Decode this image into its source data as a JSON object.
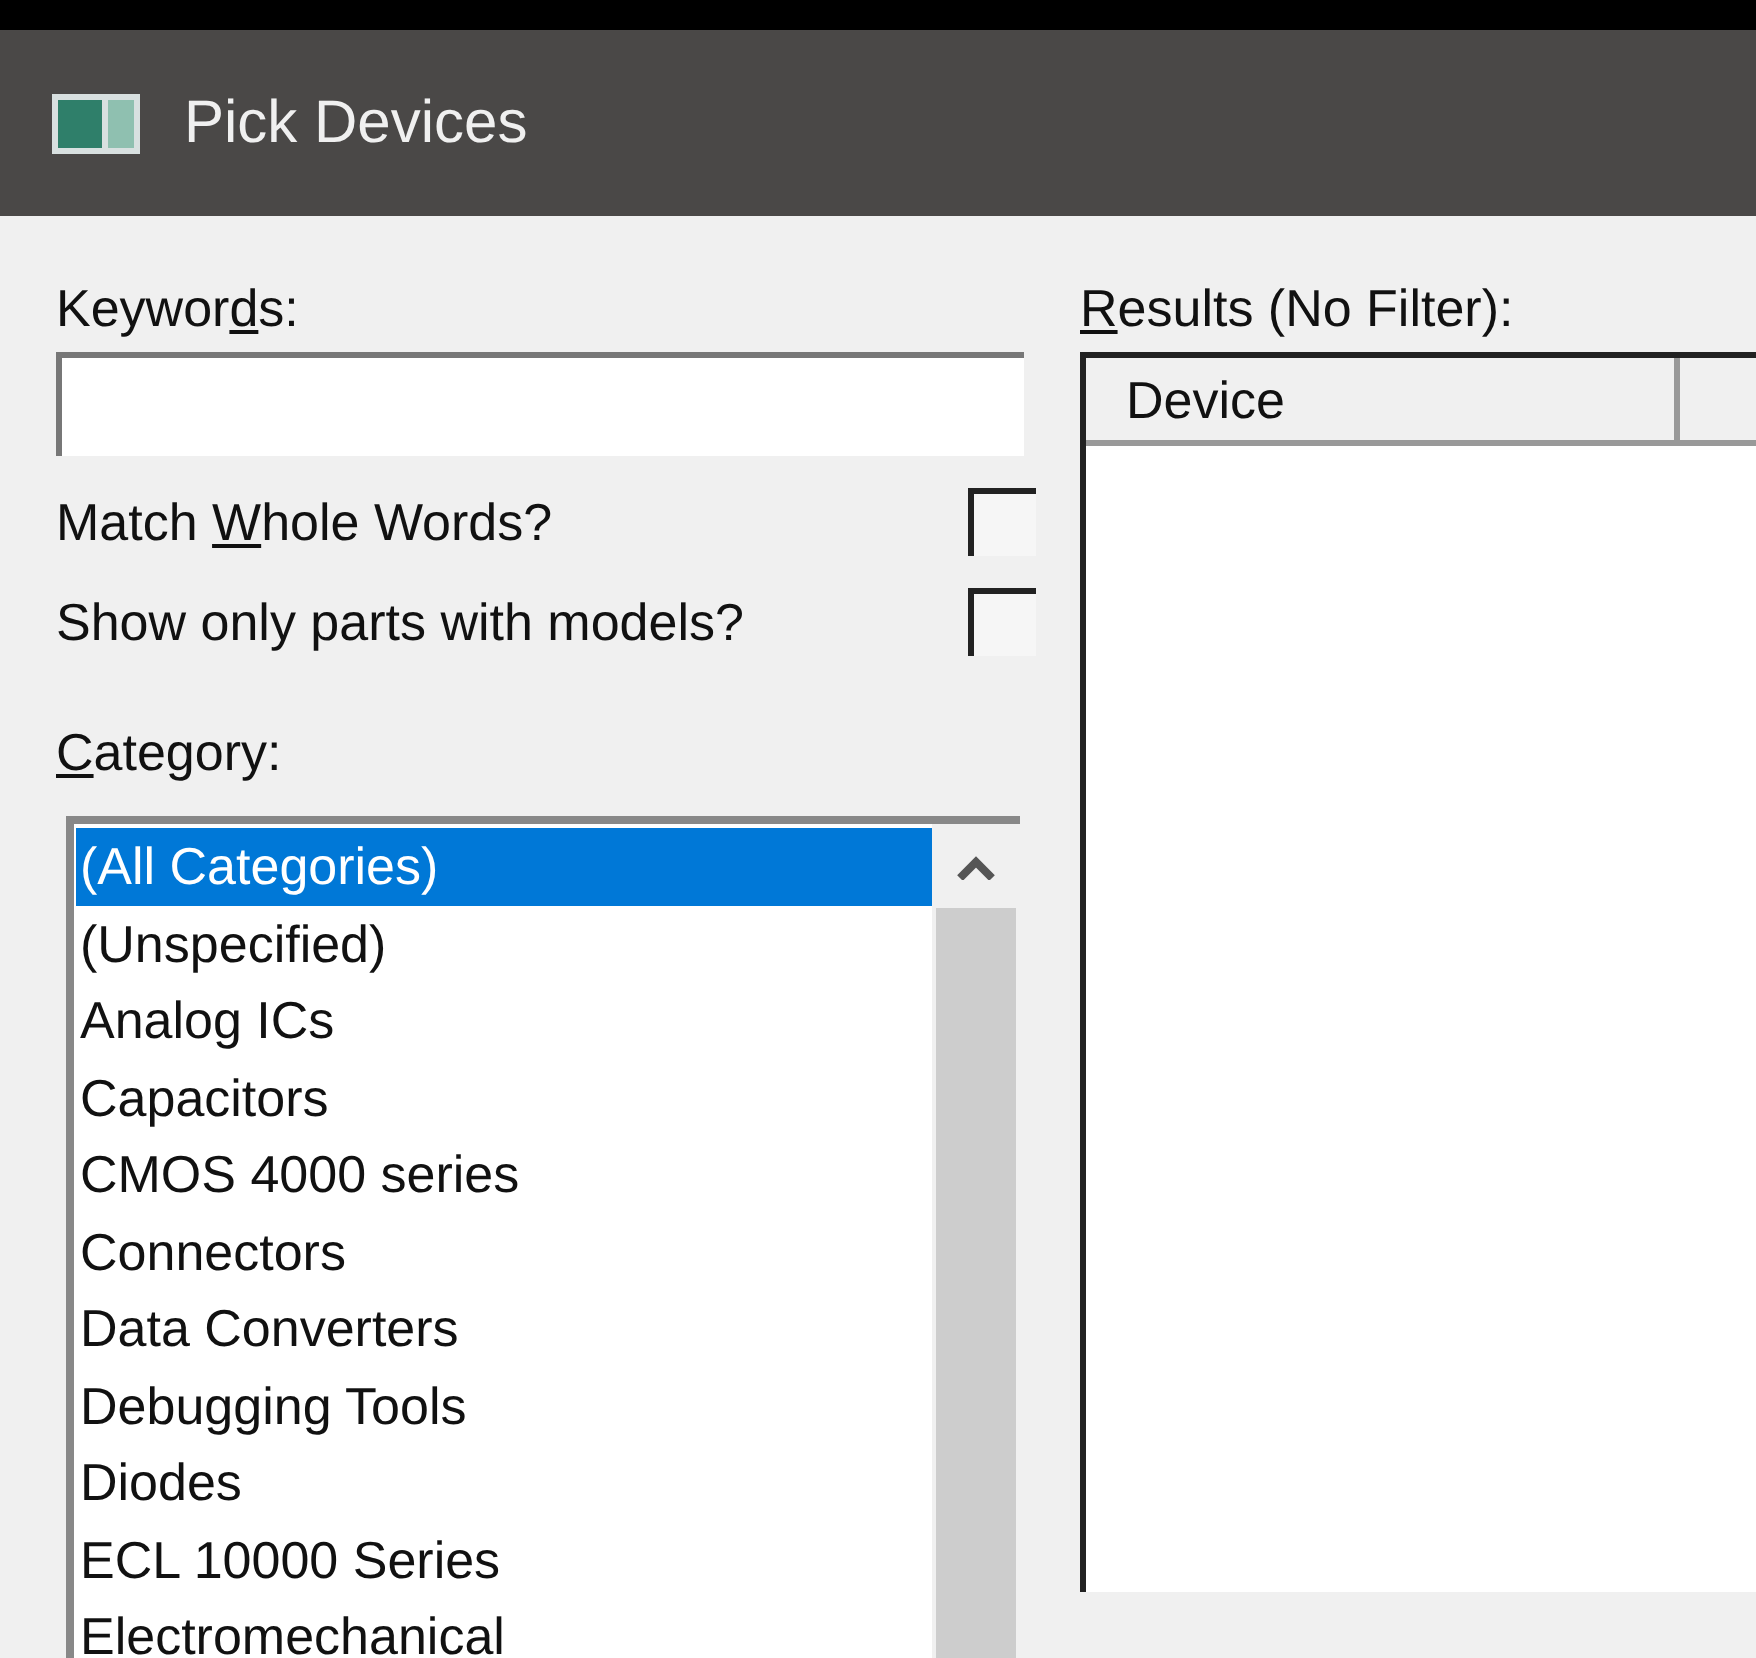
{
  "window": {
    "title": "Pick Devices"
  },
  "keywords": {
    "label_parts": {
      "before": "Keywor",
      "key": "d",
      "after": "s:"
    }
  },
  "options": [
    {
      "label_parts": {
        "before": "Match ",
        "key": "W",
        "after": "hole Words?"
      },
      "checked": false
    },
    {
      "label_parts": {
        "before": "Show only parts with models?"
      },
      "checked": false
    }
  ],
  "category": {
    "label_parts": {
      "key": "C",
      "after": "ategory:"
    },
    "items": [
      {
        "label": "(All Categories)",
        "selected": true
      },
      {
        "label": "(Unspecified)",
        "selected": false
      },
      {
        "label": "Analog ICs",
        "selected": false
      },
      {
        "label": "Capacitors",
        "selected": false
      },
      {
        "label": "CMOS 4000 series",
        "selected": false
      },
      {
        "label": "Connectors",
        "selected": false
      },
      {
        "label": "Data Converters",
        "selected": false
      },
      {
        "label": "Debugging Tools",
        "selected": false
      },
      {
        "label": "Diodes",
        "selected": false
      },
      {
        "label": "ECL 10000 Series",
        "selected": false
      },
      {
        "label": "Electromechanical",
        "selected": false
      }
    ]
  },
  "results": {
    "label_parts": {
      "key": "R",
      "after": "esults (No Filter):"
    },
    "columns": [
      "Device"
    ]
  }
}
